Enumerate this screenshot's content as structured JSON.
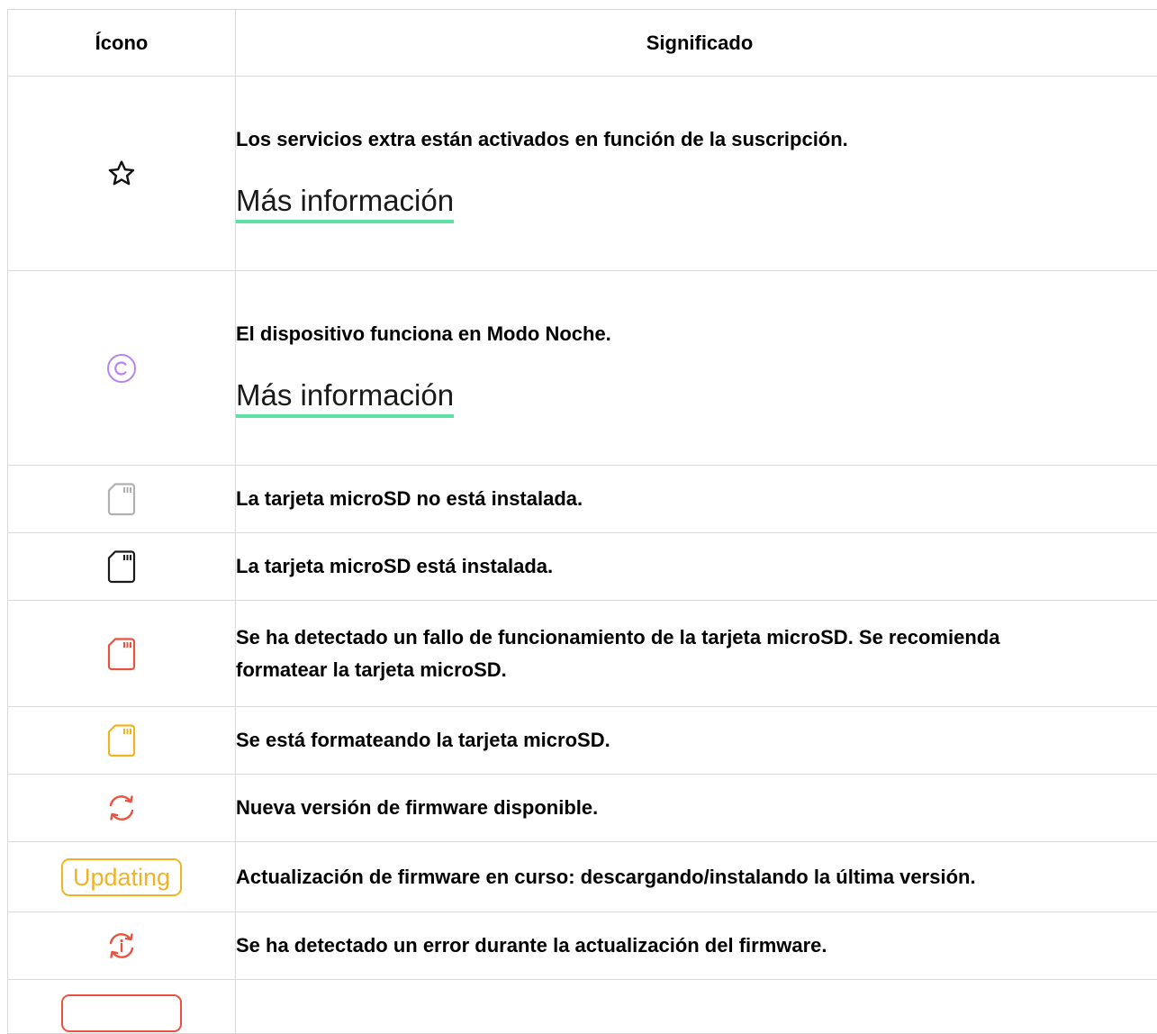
{
  "table": {
    "headers": {
      "icon": "Ícono",
      "meaning": "Significado"
    },
    "rows": [
      {
        "icon": "star-icon",
        "text": "Los servicios extra están activados en función de la suscripción.",
        "link": "Más información"
      },
      {
        "icon": "night-mode-icon",
        "text": "El dispositivo funciona en Modo Noche.",
        "link": "Más información"
      },
      {
        "icon": "microsd-not-installed-icon",
        "text": "La tarjeta microSD no está instalada."
      },
      {
        "icon": "microsd-installed-icon",
        "text": "La tarjeta microSD está instalada."
      },
      {
        "icon": "microsd-error-icon",
        "text": "Se ha detectado un fallo de funcionamiento de la tarjeta microSD. Se recomienda formatear la tarjeta microSD."
      },
      {
        "icon": "microsd-formatting-icon",
        "text": "Se está formateando la tarjeta microSD."
      },
      {
        "icon": "firmware-update-available-icon",
        "text": "Nueva versión de firmware disponible."
      },
      {
        "badge": "Updating",
        "text": "Actualización de firmware en curso: descargando/instalando la última versión."
      },
      {
        "icon": "firmware-update-error-icon",
        "text": "Se ha detectado un error durante la actualización del firmware."
      }
    ]
  },
  "colors": {
    "link_underline": "#5ee1a4",
    "night_mode": "#b784f5",
    "sd_gray": "#b0b0b0",
    "sd_black": "#1a1a1a",
    "error_red": "#e8523f",
    "updating_yellow": "#f0b323",
    "border": "#d9d9d9"
  }
}
